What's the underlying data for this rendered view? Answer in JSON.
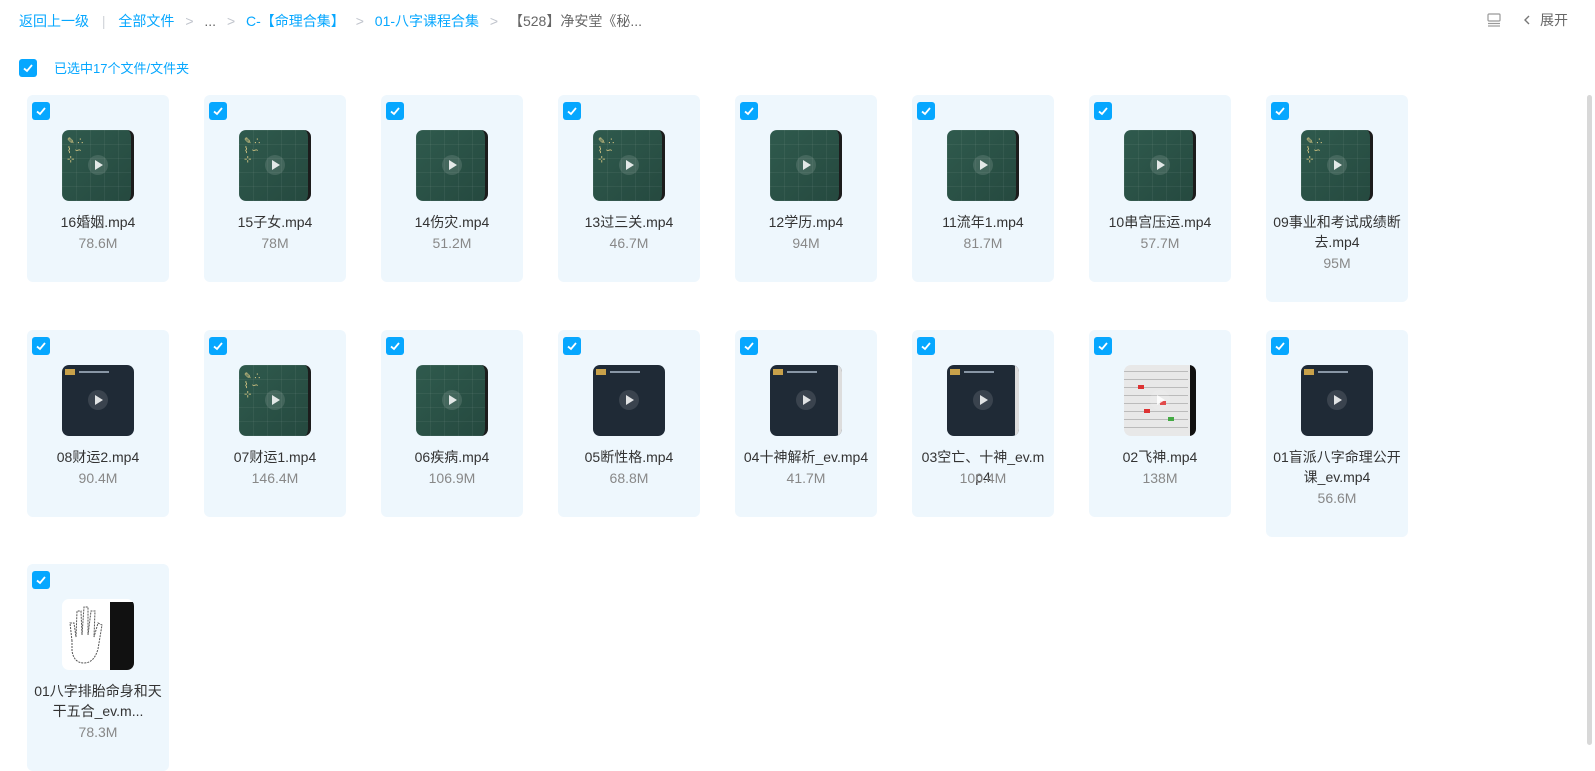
{
  "breadcrumb": {
    "back": "返回上一级",
    "items": [
      "全部文件",
      "...",
      "C-【命理合集】",
      "01-八字课程合集",
      "【528】净安堂《秘..."
    ],
    "separator": ">",
    "divider": "|"
  },
  "toolbar": {
    "expand_label": "展开",
    "expand_icon": "chevron-left-icon",
    "list_icon": "list-view-icon"
  },
  "selection": {
    "text": "已选中17个文件/文件夹",
    "checked": true
  },
  "colors": {
    "accent": "#06a7ff",
    "card_bg": "#eef7fd"
  },
  "files": [
    {
      "name": "16婚姻.mp4",
      "size": "78.6M",
      "thumb": "green"
    },
    {
      "name": "15子女.mp4",
      "size": "78M",
      "thumb": "green"
    },
    {
      "name": "14伤灾.mp4",
      "size": "51.2M",
      "thumb": "green"
    },
    {
      "name": "13过三关.mp4",
      "size": "46.7M",
      "thumb": "green"
    },
    {
      "name": "12学历.mp4",
      "size": "94M",
      "thumb": "green"
    },
    {
      "name": "11流年1.mp4",
      "size": "81.7M",
      "thumb": "green"
    },
    {
      "name": "10串宫压运.mp4",
      "size": "57.7M",
      "thumb": "green"
    },
    {
      "name": "09事业和考试成绩断去.mp4",
      "size": "95M",
      "thumb": "green"
    },
    {
      "name": "08财运2.mp4",
      "size": "90.4M",
      "thumb": "dark"
    },
    {
      "name": "07财运1.mp4",
      "size": "146.4M",
      "thumb": "green"
    },
    {
      "name": "06疾病.mp4",
      "size": "106.9M",
      "thumb": "green"
    },
    {
      "name": "05断性格.mp4",
      "size": "68.8M",
      "thumb": "dark"
    },
    {
      "name": "04十神解析_ev.mp4",
      "size": "41.7M",
      "thumb": "dark"
    },
    {
      "name": "03空亡、十神_ev.mp4",
      "size": "100.4M",
      "thumb": "dark"
    },
    {
      "name": "02飞神.mp4",
      "size": "138M",
      "thumb": "table"
    },
    {
      "name": "01盲派八字命理公开课_ev.mp4",
      "size": "56.6M",
      "thumb": "dark"
    },
    {
      "name": "01八字排胎命身和天干五合_ev.m...",
      "size": "78.3M",
      "thumb": "paper"
    }
  ]
}
